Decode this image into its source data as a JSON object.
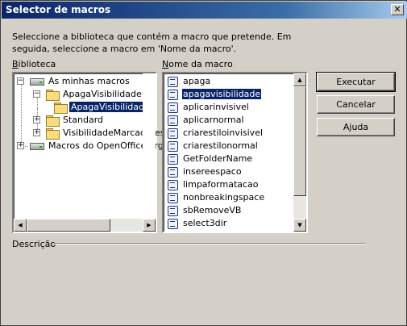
{
  "window": {
    "title": "Selector de macros",
    "close_glyph": "✕"
  },
  "instructions": "Seleccione a biblioteca que contém a macro que pretende. Em seguida, seleccione a macro em 'Nome da macro'.",
  "library": {
    "label_prefix": "B",
    "label_rest": "iblioteca",
    "tree": [
      {
        "label": "As minhas macros",
        "icon": "drive-icon",
        "expander": "−"
      },
      {
        "label": "ApagaVisibilidade",
        "icon": "folder-open-icon",
        "expander": "−"
      },
      {
        "label": "ApagaVisibilidade",
        "icon": "module-icon",
        "selected": true
      },
      {
        "label": "Standard",
        "icon": "folder-icon",
        "expander": "+"
      },
      {
        "label": "VisibilidadeMarcadores",
        "icon": "folder-icon",
        "expander": "+"
      },
      {
        "label": "Macros do OpenOffice.org",
        "icon": "drive-icon",
        "expander": "+"
      }
    ]
  },
  "macros": {
    "label_prefix": "N",
    "label_rest": "ome da macro",
    "items": [
      {
        "label": "apaga"
      },
      {
        "label": "apagavisibilidade",
        "selected": true
      },
      {
        "label": "aplicarinvisivel"
      },
      {
        "label": "aplicarnormal"
      },
      {
        "label": "criarestiloinvisivel"
      },
      {
        "label": "criarestilonormal"
      },
      {
        "label": "GetFolderName"
      },
      {
        "label": "insereespaco"
      },
      {
        "label": "limpaformatacao"
      },
      {
        "label": "nonbreakingspace"
      },
      {
        "label": "sbRemoveVB"
      },
      {
        "label": "select3dir"
      }
    ]
  },
  "buttons": {
    "execute": "Executar",
    "cancel": "Cancelar",
    "help": "Ajuda"
  },
  "description": {
    "label": "Descrição"
  },
  "scroll": {
    "up": "▲",
    "down": "▼",
    "left": "◀",
    "right": "▶"
  }
}
